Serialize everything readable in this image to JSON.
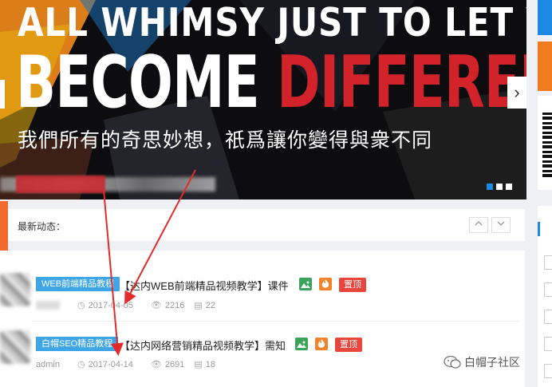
{
  "banner": {
    "headline_line1": "ALL WHIMSY JUST TO LET YOU",
    "headline_word1": "BECOME",
    "headline_word2": "DIFFERENT",
    "subtitle": "我們所有的奇思妙想，祇爲讓你變得與衆不同",
    "next_arrow": "›",
    "colors": {
      "red": "#d2232a",
      "bg": "#0d0d0f",
      "dot_active": "#1e88e5"
    }
  },
  "news_header": {
    "title": "最新动态：",
    "up_icon": "chevron-up-icon",
    "down_icon": "chevron-down-icon"
  },
  "posts": [
    {
      "category": "WEB前端精品教程",
      "title": "【达内WEB前端精品视频教学】课件",
      "top_label": "置顶",
      "author": "admin",
      "date": "2017-04-05",
      "views": "2216",
      "comments": "22"
    },
    {
      "category": "白帽SEO精品教程",
      "title": "【达内网络营销精品视频教学】需知",
      "top_label": "置顶",
      "author": "admin",
      "date": "2017-04-14",
      "views": "2691",
      "comments": "18"
    }
  ],
  "watermark": {
    "text": "白帽子社区"
  }
}
